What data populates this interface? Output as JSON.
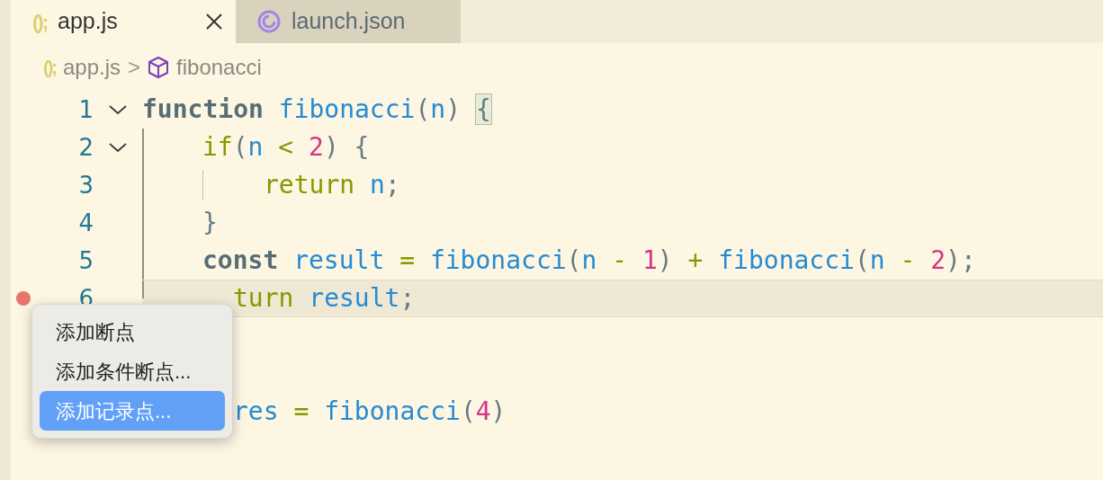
{
  "tabs": [
    {
      "icon_text": "();",
      "label": "app.js",
      "selected": true,
      "closable": true
    },
    {
      "label": "launch.json",
      "selected": false,
      "closable": false
    }
  ],
  "breadcrumb": {
    "file_icon_text": "();",
    "file": "app.js",
    "separator": ">",
    "symbol": "fibonacci"
  },
  "lines": [
    {
      "number": "1",
      "foldable": true,
      "current": false,
      "breakpoint": false,
      "tokens": [
        {
          "kind": "keyword",
          "text": "function "
        },
        {
          "kind": "name",
          "text": "fibonacci"
        },
        {
          "kind": "punct",
          "text": "("
        },
        {
          "kind": "name",
          "text": "n"
        },
        {
          "kind": "punct",
          "text": ") "
        },
        {
          "kind": "match",
          "text": "{"
        }
      ]
    },
    {
      "number": "2",
      "foldable": true,
      "current": false,
      "breakpoint": false,
      "tokens": [
        {
          "kind": "control",
          "text": "if"
        },
        {
          "kind": "punct",
          "text": "("
        },
        {
          "kind": "name",
          "text": "n"
        },
        {
          "kind": "op",
          "text": " < "
        },
        {
          "kind": "num",
          "text": "2"
        },
        {
          "kind": "punct",
          "text": ") {"
        }
      ]
    },
    {
      "number": "3",
      "foldable": false,
      "current": false,
      "breakpoint": false,
      "tokens": [
        {
          "kind": "control",
          "text": "return "
        },
        {
          "kind": "name",
          "text": "n"
        },
        {
          "kind": "punct",
          "text": ";"
        }
      ]
    },
    {
      "number": "4",
      "foldable": false,
      "current": false,
      "breakpoint": false,
      "tokens": [
        {
          "kind": "punct",
          "text": "}"
        }
      ]
    },
    {
      "number": "5",
      "foldable": false,
      "current": false,
      "breakpoint": false,
      "tokens": [
        {
          "kind": "keyword",
          "text": "const "
        },
        {
          "kind": "name",
          "text": "result"
        },
        {
          "kind": "op",
          "text": " = "
        },
        {
          "kind": "name",
          "text": "fibonacci"
        },
        {
          "kind": "punct",
          "text": "("
        },
        {
          "kind": "name",
          "text": "n"
        },
        {
          "kind": "op",
          "text": " - "
        },
        {
          "kind": "num",
          "text": "1"
        },
        {
          "kind": "punct",
          "text": ")"
        },
        {
          "kind": "op",
          "text": " + "
        },
        {
          "kind": "name",
          "text": "fibonacci"
        },
        {
          "kind": "punct",
          "text": "("
        },
        {
          "kind": "name",
          "text": "n"
        },
        {
          "kind": "op",
          "text": " - "
        },
        {
          "kind": "num",
          "text": "2"
        },
        {
          "kind": "punct",
          "text": ");"
        }
      ]
    },
    {
      "number": "6",
      "foldable": false,
      "current": true,
      "breakpoint": true,
      "tokens": [
        {
          "kind": "control",
          "text": "turn "
        },
        {
          "kind": "name",
          "text": "result"
        },
        {
          "kind": "punct",
          "text": ";"
        }
      ]
    },
    {
      "foldable": false,
      "current": false,
      "breakpoint": false
    },
    {
      "foldable": false,
      "current": false,
      "breakpoint": false
    },
    {
      "foldable": false,
      "current": false,
      "breakpoint": false,
      "tokens": [
        {
          "kind": "name",
          "text": "res"
        },
        {
          "kind": "op",
          "text": " = "
        },
        {
          "kind": "name",
          "text": "fibonacci"
        },
        {
          "kind": "punct",
          "text": "("
        },
        {
          "kind": "num",
          "text": "4"
        },
        {
          "kind": "punct",
          "text": ")"
        }
      ]
    }
  ],
  "context_menu": [
    {
      "label": "添加断点",
      "selected": false
    },
    {
      "label": "添加条件断点...",
      "selected": false
    },
    {
      "label": "添加记录点...",
      "selected": true
    }
  ]
}
